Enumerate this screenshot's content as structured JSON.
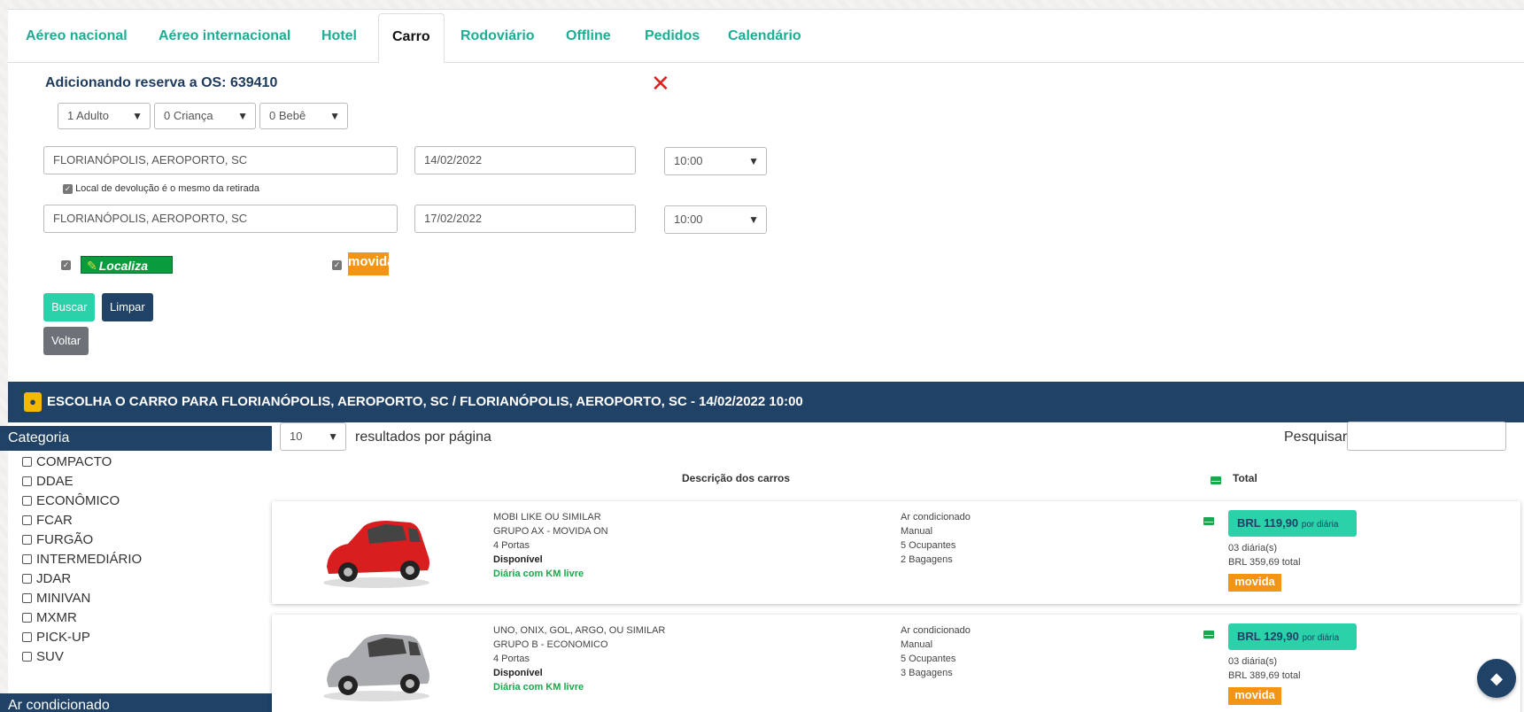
{
  "tabs": [
    {
      "label": "Aéreo nacional"
    },
    {
      "label": "Aéreo internacional"
    },
    {
      "label": "Hotel"
    },
    {
      "label": "Carro"
    },
    {
      "label": "Rodoviário"
    },
    {
      "label": "Offline"
    },
    {
      "label": "Pedidos"
    },
    {
      "label": "Calendário"
    }
  ],
  "active_tab": "Carro",
  "form": {
    "title": "Adicionando reserva a OS: 639410",
    "adults": "1 Adulto",
    "children": "0 Criança",
    "babies": "0 Bebê",
    "pickup_location": "FLORIANÓPOLIS, AEROPORTO, SC",
    "pickup_date": "14/02/2022",
    "pickup_time": "10:00",
    "same_return_label": "Local de devolução é o mesmo da retirada",
    "return_location": "FLORIANÓPOLIS, AEROPORTO, SC",
    "return_date": "17/02/2022",
    "return_time": "10:00",
    "rental_companies": [
      "Localiza",
      "movida"
    ],
    "search_label": "Buscar",
    "clear_label": "Limpar",
    "back_label": "Voltar"
  },
  "banner": {
    "text": "ESCOLHA O CARRO PARA FLORIANÓPOLIS, AEROPORTO, SC / FLORIANÓPOLIS, AEROPORTO, SC - 14/02/2022 10:00"
  },
  "sidebar": {
    "category_title": "Categoria",
    "categories": [
      "COMPACTO",
      "DDAE",
      "ECONÔMICO",
      "FCAR",
      "FURGÃO",
      "INTERMEDIÁRIO",
      "JDAR",
      "MINIVAN",
      "MXMR",
      "PICK-UP",
      "SUV"
    ],
    "ac_title": "Ar condicionado"
  },
  "results": {
    "per_page": "10",
    "per_page_label": "resultados por página",
    "search_label": "Pesquisar",
    "col_desc": "Descrição dos carros",
    "col_total": "Total",
    "cars": [
      {
        "name": "MOBI LIKE OU SIMILAR",
        "group": "GRUPO AX - MOVIDA ON",
        "doors": "4 Portas",
        "availability": "Disponível",
        "km": "Diária com KM livre",
        "ac": "Ar condicionado",
        "transmission": "Manual",
        "occupants": "5 Ocupantes",
        "bags": "2 Bagagens",
        "price": "BRL 119,90",
        "per_day": "por diária",
        "days": "03 diária(s)",
        "total": "BRL 359,69 total",
        "company": "movida",
        "color": "#d81e1e"
      },
      {
        "name": "UNO, ONIX, GOL, ARGO, OU SIMILAR",
        "group": "GRUPO B - ECONOMICO",
        "doors": "4 Portas",
        "availability": "Disponível",
        "km": "Diária com KM livre",
        "ac": "Ar condicionado",
        "transmission": "Manual",
        "occupants": "5 Ocupantes",
        "bags": "3 Bagagens",
        "price": "BRL 129,90",
        "per_day": "por diária",
        "days": "03 diária(s)",
        "total": "BRL 389,69 total",
        "company": "movida",
        "color": "#a9abae"
      }
    ]
  }
}
